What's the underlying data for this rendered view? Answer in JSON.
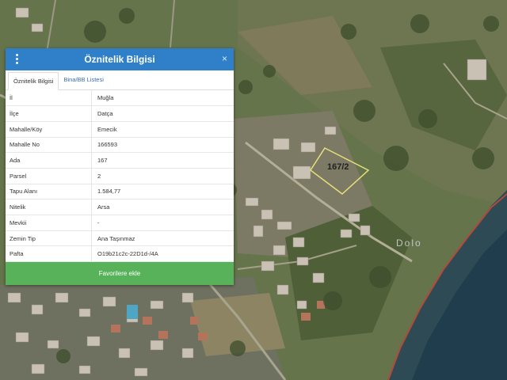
{
  "map": {
    "parcel_label": "167/2",
    "place_label": "Dolo"
  },
  "panel": {
    "title": "Öznitelik Bilgisi",
    "close_symbol": "×",
    "menu_icon": "vertical-dots-icon",
    "accent_color": "#2f80c9",
    "button_color": "#57b25a",
    "tabs": [
      {
        "label": "Öznitelik Bilgisi",
        "active": true
      },
      {
        "label": "Bina/BB Listesi",
        "active": false
      }
    ],
    "rows": [
      {
        "key": "İl",
        "value": "Muğla"
      },
      {
        "key": "İlçe",
        "value": "Datça"
      },
      {
        "key": "Mahalle/Köy",
        "value": "Emecik"
      },
      {
        "key": "Mahalle No",
        "value": "166593"
      },
      {
        "key": "Ada",
        "value": "167"
      },
      {
        "key": "Parsel",
        "value": "2"
      },
      {
        "key": "Tapu Alanı",
        "value": "1.584,77"
      },
      {
        "key": "Nitelik",
        "value": "Arsa"
      },
      {
        "key": "Mevkii",
        "value": "-"
      },
      {
        "key": "Zemin Tip",
        "value": "Ana Taşınmaz"
      },
      {
        "key": "Pafta",
        "value": "O19b21c2c-22D1d-/4A"
      }
    ],
    "favorite_button": "Favorilere ekle"
  }
}
